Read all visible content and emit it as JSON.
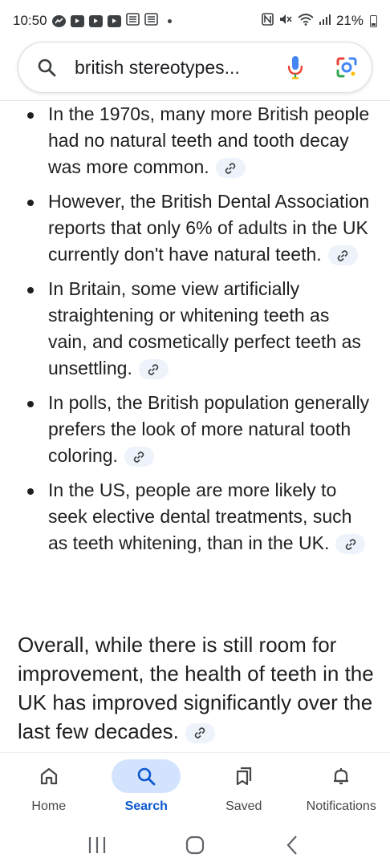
{
  "status_bar": {
    "time": "10:50",
    "battery": "21%",
    "icons": [
      "messenger-icon",
      "youtube-icon",
      "youtube-icon",
      "youtube-icon",
      "news-icon",
      "news-icon",
      "nfc-icon",
      "mute-icon",
      "wifi-icon",
      "signal-icon",
      "battery-icon"
    ]
  },
  "search": {
    "query": "british stereotypes...",
    "icons": [
      "search-icon",
      "mic-icon",
      "lens-icon"
    ]
  },
  "bullets": [
    {
      "text": "In the 1970s, many more British people had no natural teeth and tooth decay was more common."
    },
    {
      "text": "However, the British Dental Association reports that only 6% of adults in the UK currently don't have natural teeth."
    },
    {
      "text": "In Britain, some view artificially straightening or whitening teeth as vain, and cosmetically perfect teeth as unsettling."
    },
    {
      "text": "In polls, the British population generally prefers the look of more natural tooth coloring."
    },
    {
      "text": "In the US, people are more likely to seek elective dental treatments, such as teeth whitening, than in the UK."
    }
  ],
  "summary": "Overall, while there is still room for improvement, the health of teeth in the UK has improved significantly over the last few decades.",
  "bottom_nav": {
    "items": [
      {
        "label": "Home",
        "icon": "home-icon",
        "active": false
      },
      {
        "label": "Search",
        "icon": "search-icon",
        "active": true
      },
      {
        "label": "Saved",
        "icon": "bookmarks-icon",
        "active": false
      },
      {
        "label": "Notifications",
        "icon": "bell-icon",
        "active": false
      }
    ]
  },
  "colors": {
    "accent": "#0b57d0",
    "active_pill": "#d3e3fd",
    "citation_chip": "#eef2fb",
    "text": "#1f1f1f"
  }
}
